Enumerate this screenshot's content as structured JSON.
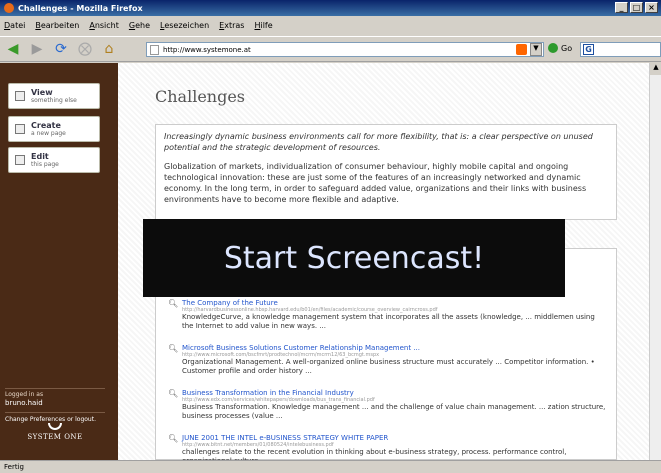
{
  "window": {
    "title": "Challenges - Mozilla Firefox"
  },
  "menu": [
    "Datei",
    "Bearbeiten",
    "Ansicht",
    "Gehe",
    "Lesezeichen",
    "Extras",
    "Hilfe"
  ],
  "toolbar": {
    "url": "http://www.systemone.at",
    "go_label": "Go"
  },
  "sidebar": {
    "buttons": [
      {
        "label": "View",
        "sub": "something else"
      },
      {
        "label": "Create",
        "sub": "a new page"
      },
      {
        "label": "Edit",
        "sub": "this page"
      }
    ],
    "logged_in_label": "Logged in as",
    "username": "bruno.haid",
    "prefs_text": "Change Preferences or logout.",
    "logo_text": "SYSTEM ONE"
  },
  "page": {
    "title": "Challenges",
    "lead": "Increasingly dynamic business environments call for more flexibility, that is: a clear perspective on unused potential and the strategic development of resources.",
    "body": "Globalization of markets, individualization of consumer behaviour, highly mobile capital and ongoing technological innovation: these are just some of the features of an increasingly networked and dynamic economy. In the long term, in order to safeguard added value, organizations and their links with business environments have to become more flexible and adaptive."
  },
  "results": [
    {
      "title": "The Company of the Future",
      "url": "http://harvardbusinessonline.hbsp.harvard.edu/b01/en/files/academic/course_overview_cairncross.pdf",
      "snippet": "KnowledgeCurve, a knowledge management system that incorporates all the assets (knowledge, ... middlemen using the Internet to add value in new ways. ..."
    },
    {
      "title": "Microsoft Business Solutions Customer Relationship Management ...",
      "url": "http://www.microsoft.com/bscfmrt/prodtechnol/mcrm/mcrm12/63_bcmgt.mspx",
      "snippet": "Organizational Management. A well-organized online business structure must accurately ... Competitor information. • Customer profile and order history ..."
    },
    {
      "title": "Business Transformation in the Financial Industry",
      "url": "http://www.edx.com/services/whitepapers/downloads/bus_trans_financial.pdf",
      "snippet": "Business Transformation. Knowledge management ... and the challenge of value chain management. ... zation structure, business processes (value ..."
    },
    {
      "title": "JUNE 2001 THE INTEL e-BUSINESS STRATEGY WHITE PAPER",
      "url": "http://www.bitnt.net/members/01/080524/intelebusiness.pdf",
      "snippet": "challenges relate to the recent evolution in thinking about e-business strategy, process. performance control, organizational culture,"
    }
  ],
  "overlay": {
    "text": "Start Screencast!"
  },
  "status": "Fertig"
}
